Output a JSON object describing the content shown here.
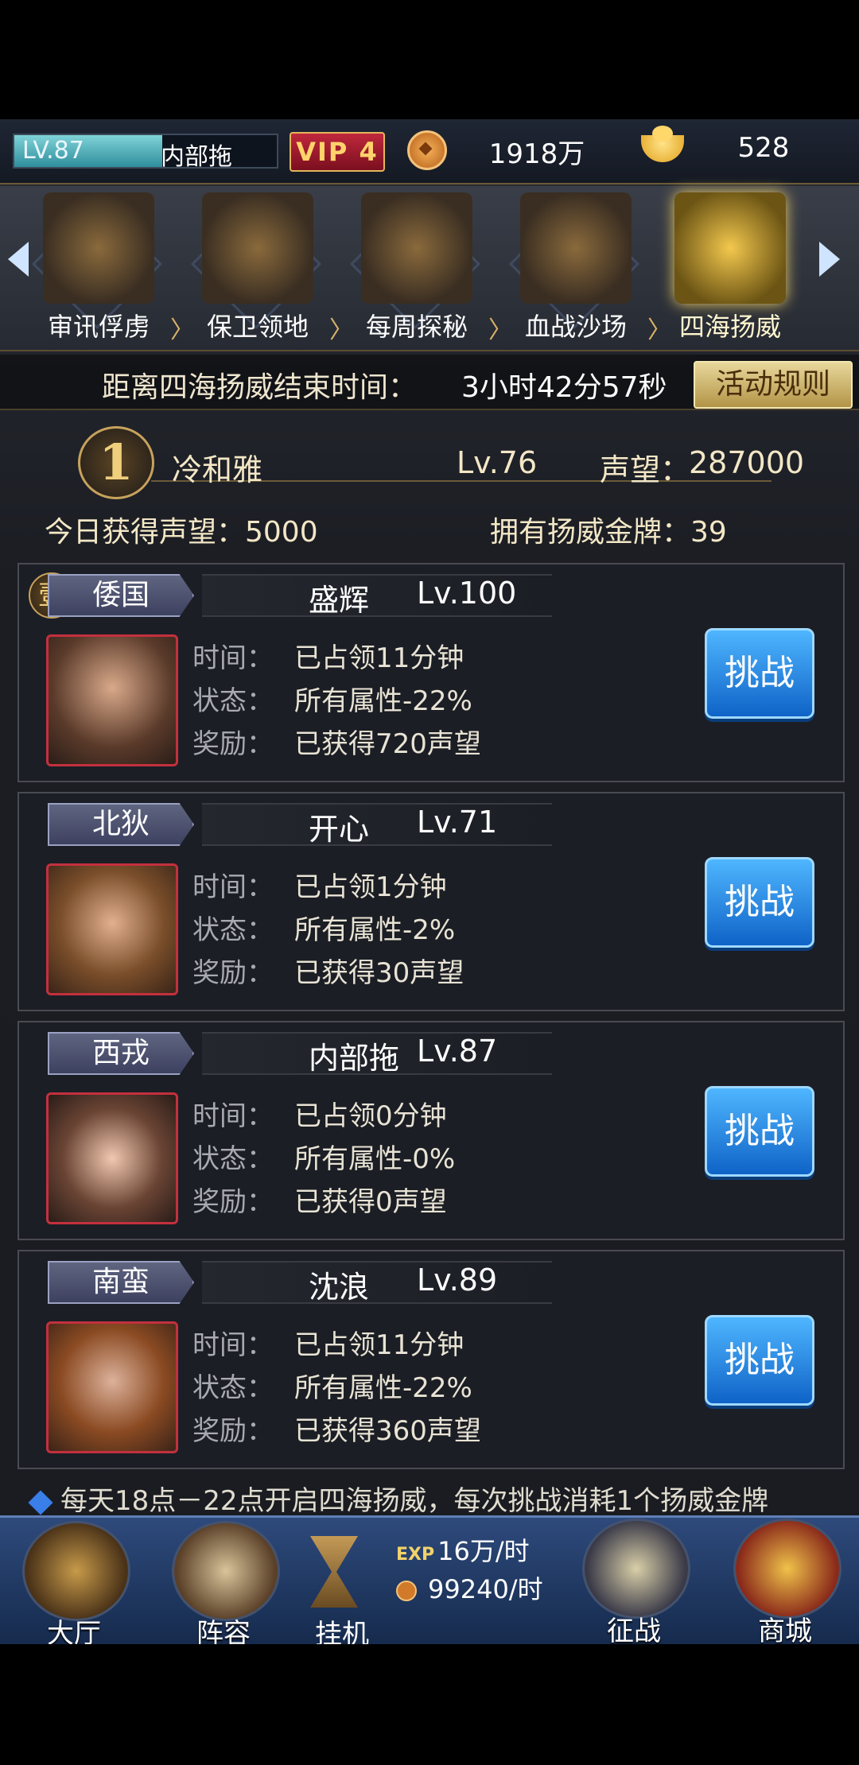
{
  "topbar": {
    "level": "LV.87",
    "player_name": "内部拖",
    "vip": "VIP 4",
    "coins": "1918万",
    "gold": "528"
  },
  "tabs": [
    {
      "label": "审讯俘虏",
      "icon": "prisoner-icon",
      "active": false
    },
    {
      "label": "保卫领地",
      "icon": "tower-icon",
      "active": false
    },
    {
      "label": "每周探秘",
      "icon": "treasure-icon",
      "active": false
    },
    {
      "label": "血战沙场",
      "icon": "warrior-icon",
      "active": false
    },
    {
      "label": "四海扬威",
      "icon": "swords-icon",
      "active": true
    }
  ],
  "timer": {
    "label": "距离四海扬威结束时间：",
    "value": "3小时42分57秒",
    "rules_button": "活动规则"
  },
  "me": {
    "rank": "1",
    "name": "冷和雅",
    "level": "Lv.76",
    "fame_label": "声望：",
    "fame": "287000",
    "today_fame": "今日获得声望：5000",
    "medals": "拥有扬威金牌：39"
  },
  "labels": {
    "time": "时间：",
    "status": "状态：",
    "reward": "奖励：",
    "challenge": "挑战"
  },
  "opponents": [
    {
      "ordinal": "壹",
      "region": "倭国",
      "name": "盛辉",
      "level": "Lv.100",
      "time": "已占领11分钟",
      "status": "所有属性-22%",
      "reward": "已获得720声望"
    },
    {
      "ordinal": "",
      "region": "北狄",
      "name": "开心",
      "level": "Lv.71",
      "time": "已占领1分钟",
      "status": "所有属性-2%",
      "reward": "已获得30声望"
    },
    {
      "ordinal": "",
      "region": "西戎",
      "name": "内部拖",
      "level": "Lv.87",
      "time": "已占领0分钟",
      "status": "所有属性-0%",
      "reward": "已获得0声望"
    },
    {
      "ordinal": "",
      "region": "南蛮",
      "name": "沈浪",
      "level": "Lv.89",
      "time": "已占领11分钟",
      "status": "所有属性-22%",
      "reward": "已获得360声望"
    }
  ],
  "footnote": "每天18点－22点开启四海扬威，每次挑战消耗1个扬威金牌",
  "nav": {
    "hall": "大厅",
    "lineup": "阵容",
    "idle": "挂机",
    "exp_tag": "EXP",
    "exp_rate": "16万/时",
    "coin_rate": "99240/时",
    "campaign": "征战",
    "shop": "商城"
  },
  "colors": {
    "accent_gold": "#f0cf7c",
    "button_blue": "#0f63c7",
    "portrait_border": "#c3303e"
  }
}
